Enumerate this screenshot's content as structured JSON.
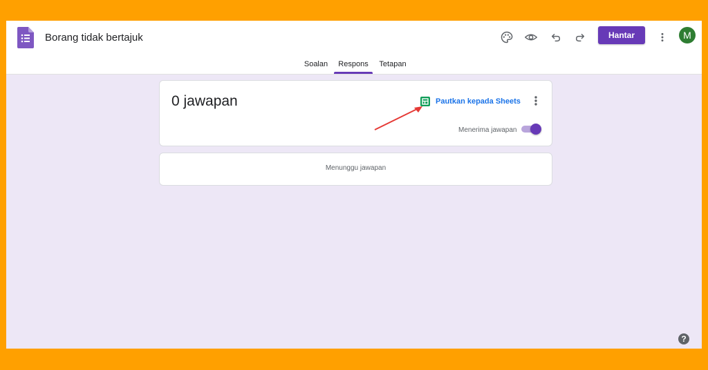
{
  "header": {
    "title": "Borang tidak bertajuk",
    "send_label": "Hantar",
    "avatar_initial": "M",
    "icons": [
      "palette-icon",
      "preview-icon",
      "undo-icon",
      "redo-icon",
      "more-vert-icon"
    ]
  },
  "tabs": [
    {
      "label": "Soalan",
      "active": false
    },
    {
      "label": "Respons",
      "active": true
    },
    {
      "label": "Tetapan",
      "active": false
    }
  ],
  "summary": {
    "count_title": "0 jawapan",
    "sheets_link": "Pautkan kepada Sheets",
    "accepting_label": "Menerima jawapan",
    "accepting_enabled": true
  },
  "waiting": {
    "text": "Menunggu jawapan"
  },
  "colors": {
    "frame": "#ffa000",
    "accent": "#673ab7",
    "background": "#ede7f6",
    "sheets": "#0f9d58",
    "link": "#1a73e8",
    "annotation_arrow": "#e53935"
  }
}
